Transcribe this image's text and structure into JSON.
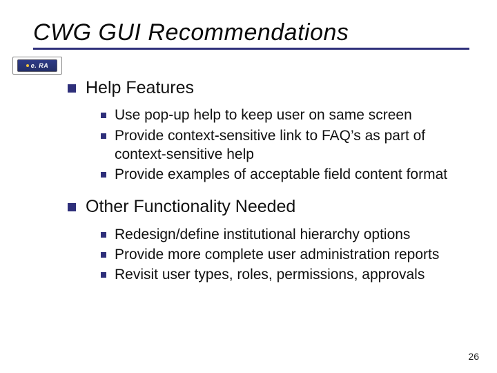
{
  "title": "CWG GUI Recommendations",
  "logo_text": "e. RA",
  "sections": [
    {
      "heading": "Help Features",
      "items": [
        "Use pop-up help to keep user on same screen",
        "Provide context-sensitive link to FAQ’s as part of context-sensitive help",
        "Provide examples of acceptable field content format"
      ]
    },
    {
      "heading": "Other Functionality Needed",
      "items": [
        "Redesign/define institutional hierarchy options",
        "Provide more complete user administration reports",
        "Revisit user types, roles, permissions, approvals"
      ]
    }
  ],
  "page_number": "26"
}
